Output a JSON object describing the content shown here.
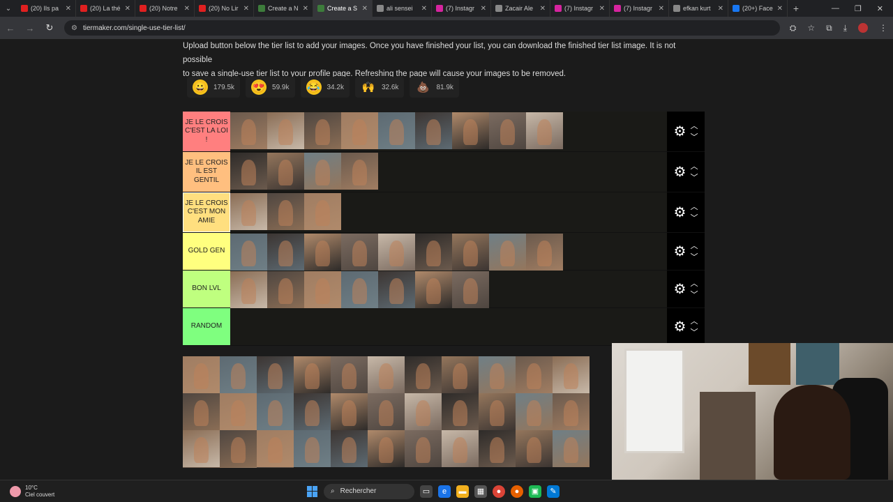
{
  "browser": {
    "tabs": [
      {
        "title": "(20) Ils pa",
        "color": "#e02020"
      },
      {
        "title": "(20) La thé",
        "color": "#e02020"
      },
      {
        "title": "(20) Notre",
        "color": "#e02020"
      },
      {
        "title": "(20) No Lir",
        "color": "#e02020"
      },
      {
        "title": "Create a N",
        "color": "#3d7c3b"
      },
      {
        "title": "Create a S",
        "color": "#3d7c3b",
        "active": true
      },
      {
        "title": "ali sensei",
        "color": "#888888"
      },
      {
        "title": "(7) Instagr",
        "color": "#d6249f"
      },
      {
        "title": "Zacair Ale",
        "color": "#888888"
      },
      {
        "title": "(7) Instagr",
        "color": "#d6249f"
      },
      {
        "title": "(7) Instagr",
        "color": "#d6249f"
      },
      {
        "title": "efkan kurt",
        "color": "#888888"
      },
      {
        "title": "(20+) Face",
        "color": "#1877f2"
      }
    ],
    "url": "tiermaker.com/single-use-tier-list/"
  },
  "page": {
    "intro_line1": "Upload button below the tier list to add your images. Once you have finished your list, you can download the finished tier list image. It is not possible",
    "intro_line2": "to save a single-use tier list to your profile page. Refreshing the page will cause your images to be removed.",
    "reactions": [
      {
        "emoji": "😀",
        "count": "179.5k",
        "bg": "#f5c21b"
      },
      {
        "emoji": "😍",
        "count": "59.9k",
        "bg": "#f5c21b"
      },
      {
        "emoji": "😂",
        "count": "34.2k",
        "bg": "#f5c21b"
      },
      {
        "emoji": "🙌",
        "count": "32.6k",
        "bg": "transparent"
      },
      {
        "emoji": "💩",
        "count": "81.9k",
        "bg": "transparent"
      }
    ]
  },
  "tiers": [
    {
      "label": "JE LE CROIS C'EST LA LOI !",
      "color": "#ff7f7f",
      "count": 9
    },
    {
      "label": "JE LE CROIS IL EST GENTIL",
      "color": "#ffbf7f",
      "count": 4
    },
    {
      "label": "JE LE CROIS C'EST MON AMIE",
      "color": "#ffdf7f",
      "count": 3
    },
    {
      "label": "GOLD GEN",
      "color": "#ffff7f",
      "count": 9
    },
    {
      "label": "BON LVL",
      "color": "#bfff7f",
      "count": 7
    },
    {
      "label": "RANDOM",
      "color": "#7fff7f",
      "count": 0
    }
  ],
  "pool_count": 36,
  "taskbar": {
    "temp": "10°C",
    "weather": "Ciel couvert",
    "search": "Rechercher"
  }
}
